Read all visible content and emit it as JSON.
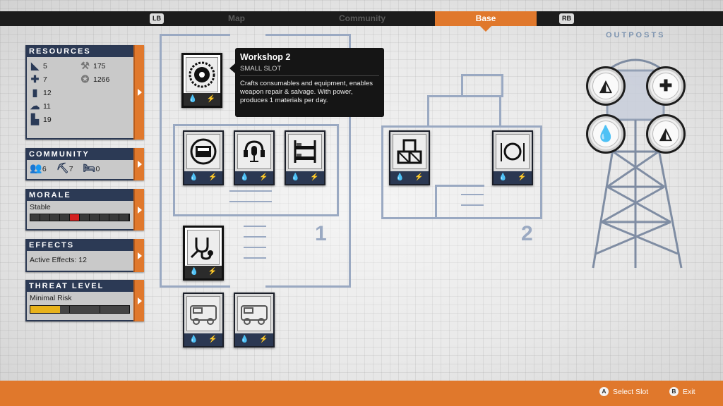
{
  "top_tabs": {
    "left_shoulder": "LB",
    "right_shoulder": "RB",
    "tabs": [
      {
        "label": "Map",
        "active": false
      },
      {
        "label": "Community",
        "active": false
      },
      {
        "label": "Base",
        "active": true
      }
    ]
  },
  "outposts": {
    "title": "OUTPOSTS",
    "buttons": [
      {
        "icon": "pizza-slice-icon"
      },
      {
        "icon": "medical-cross-icon"
      },
      {
        "icon": "water-drop-icon"
      },
      {
        "icon": "pizza-slice-icon"
      }
    ]
  },
  "resources": {
    "title": "RESOURCES",
    "items": [
      {
        "icon": "food-icon",
        "value": "5"
      },
      {
        "icon": "wrench-icon",
        "value": "175"
      },
      {
        "icon": "medicine-icon",
        "value": "7"
      },
      {
        "icon": "influence-icon",
        "value": "1266"
      },
      {
        "icon": "ammo-icon",
        "value": "12"
      },
      {
        "icon": "materials-icon",
        "value": "11"
      },
      {
        "icon": "fuel-icon",
        "value": "19"
      }
    ]
  },
  "community": {
    "title": "COMMUNITY",
    "survivors": "6",
    "workers": "7",
    "injured": "0"
  },
  "morale": {
    "title": "MORALE",
    "status": "Stable",
    "segments": 10,
    "level_index": 4
  },
  "effects": {
    "title": "EFFECTS",
    "text": "Active Effects: 12"
  },
  "threat": {
    "title": "THREAT LEVEL",
    "status": "Minimal Risk",
    "fill_fraction": 0.3,
    "marker_fractions": [
      0.39,
      0.7
    ]
  },
  "tooltip": {
    "title": "Workshop 2",
    "subtitle": "SMALL SLOT",
    "description": "Crafts consumables and equipment, enables weapon repair & salvage. With power, produces 1 materials per day."
  },
  "base": {
    "area_numbers": [
      "1",
      "2"
    ],
    "slots": [
      {
        "name": "workshop",
        "icon": "saw-blade-icon"
      },
      {
        "name": "kitchen",
        "icon": "stove-icon"
      },
      {
        "name": "radio",
        "icon": "radio-microphone-icon"
      },
      {
        "name": "beds",
        "icon": "bunk-bed-icon"
      },
      {
        "name": "infirmary",
        "icon": "stethoscope-icon"
      },
      {
        "name": "storage",
        "icon": "crates-icon"
      },
      {
        "name": "dining",
        "icon": "plate-icon"
      },
      {
        "name": "garage-1",
        "icon": "vehicle-icon"
      },
      {
        "name": "garage-2",
        "icon": "vehicle-icon"
      }
    ],
    "water_glyph": "💧",
    "power_glyph": "⚡"
  },
  "footer": {
    "select_button": "A",
    "select_label": "Select Slot",
    "exit_button": "B",
    "exit_label": "Exit"
  }
}
